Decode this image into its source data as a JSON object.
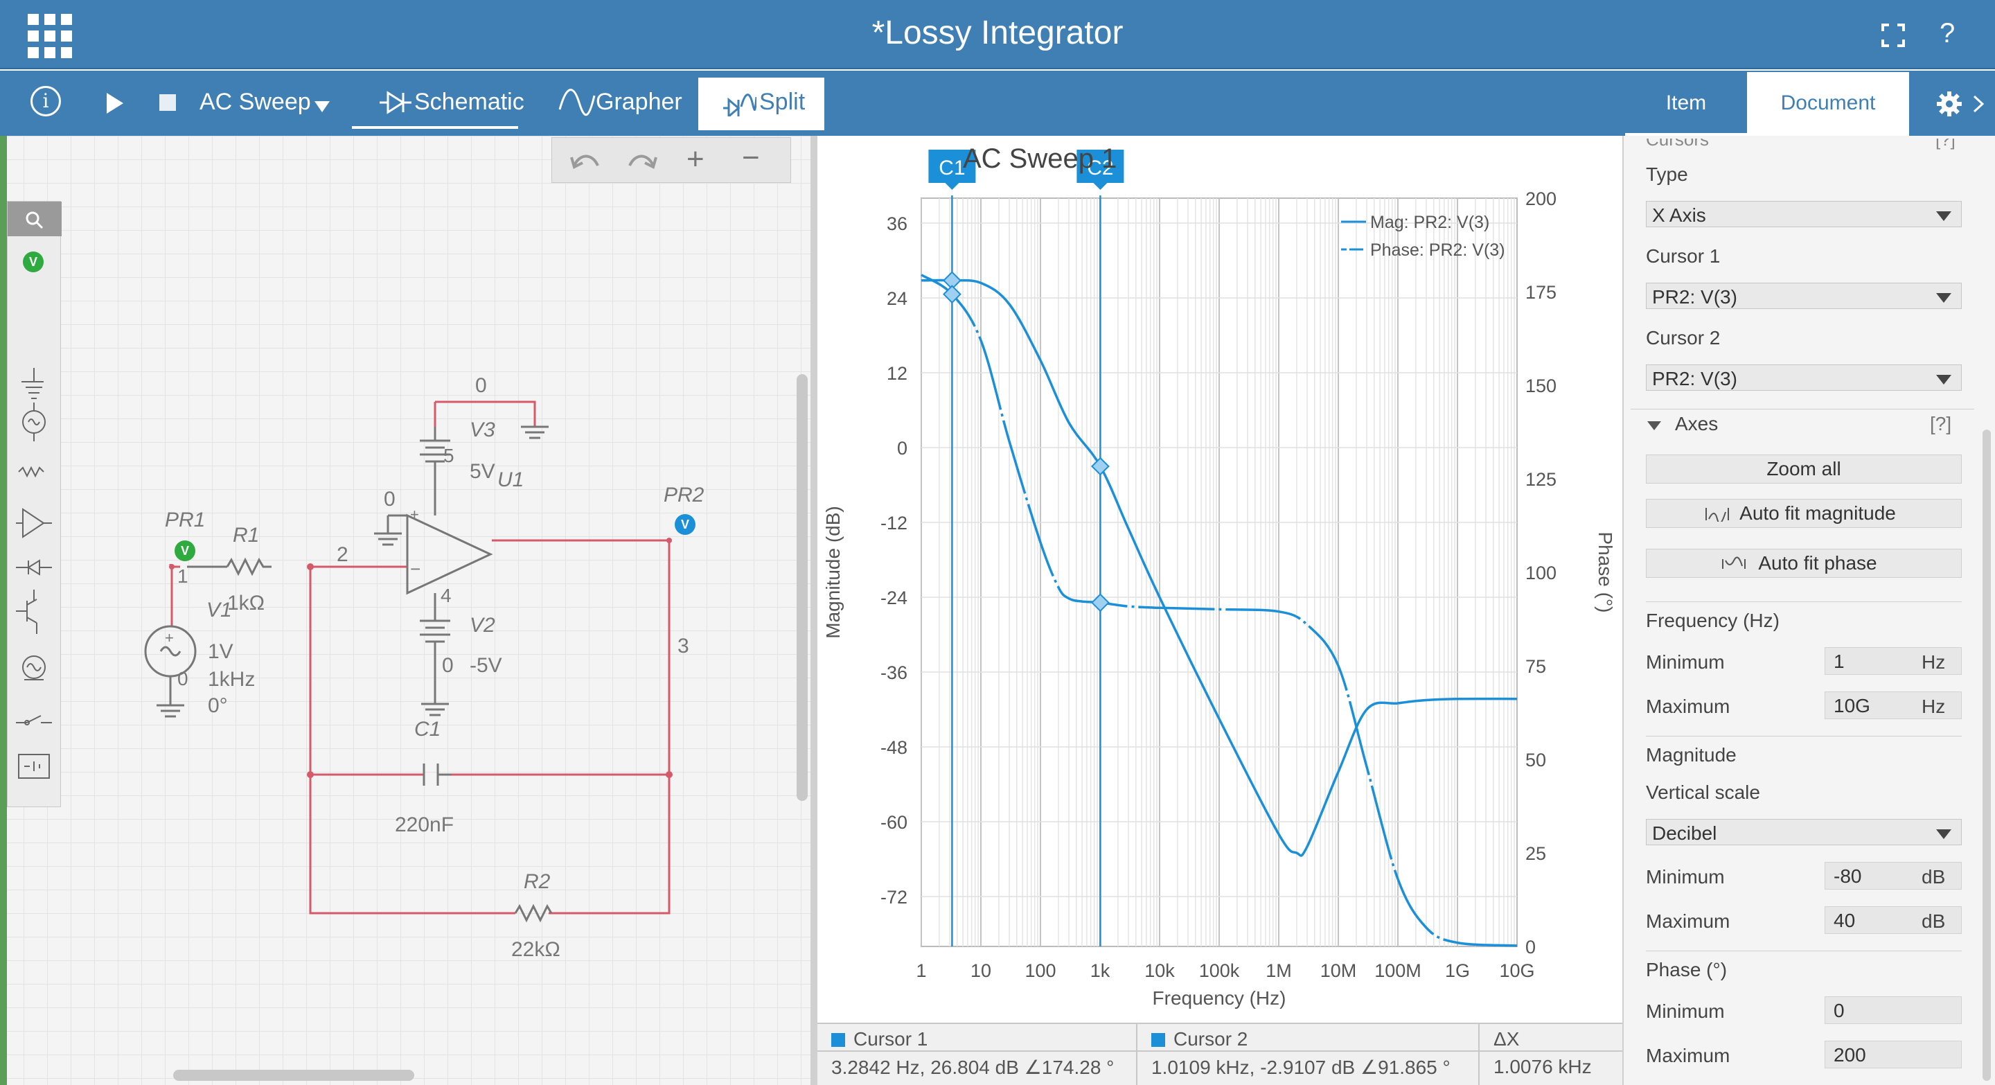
{
  "app": {
    "title": "*Lossy Integrator",
    "help": "?"
  },
  "toolbar": {
    "analysis": "AC Sweep",
    "tabs": {
      "schematic": "Schematic",
      "grapher": "Grapher",
      "split": "Split"
    },
    "info": "i"
  },
  "right_tabs": {
    "item": "Item",
    "document": "Document"
  },
  "schematic": {
    "labels": {
      "pr1": "PR1",
      "pr2": "PR2",
      "r1": "R1",
      "r1_val": "1kΩ",
      "r2": "R2",
      "r2_val": "22kΩ",
      "v1": "V1",
      "v1_amp": "1V",
      "v1_freq": "1kHz",
      "v1_phase": "0°",
      "v2": "V2",
      "v2_val": "-5V",
      "v3": "V3",
      "v3_val": "5V",
      "u1": "U1",
      "c1": "C1",
      "c1_val": "220nF",
      "node0a": "0",
      "node0b": "0",
      "node0c": "0",
      "node0d": "0",
      "node1": "1",
      "node2": "2",
      "node3": "3",
      "node4": "4",
      "node5": "5",
      "probe_v": "V"
    },
    "toolbar": {
      "plus": "+",
      "minus": "−"
    }
  },
  "chart_data": {
    "type": "line",
    "title": "AC Sweep 1",
    "xlabel": "Frequency (Hz)",
    "ylabel": "Magnitude (dB)",
    "y2label": "Phase (°)",
    "xscale": "log",
    "xlim": [
      1,
      10000000000
    ],
    "ylim": [
      -80,
      40
    ],
    "y2lim": [
      0,
      200
    ],
    "xticks": [
      "1",
      "10",
      "100",
      "1k",
      "10k",
      "100k",
      "1M",
      "10M",
      "100M",
      "1G",
      "10G"
    ],
    "yticks": [
      "36",
      "24",
      "12",
      "0",
      "-12",
      "-24",
      "-36",
      "-48",
      "-60",
      "-72"
    ],
    "y2ticks": [
      "200",
      "175",
      "150",
      "125",
      "100",
      "75",
      "50",
      "25",
      "0"
    ],
    "grid": true,
    "legend_position": "top-right",
    "series": [
      {
        "name": "Mag: PR2: V(3)",
        "axis": "left",
        "color": "#1b8fd8",
        "x": [
          1,
          3.3,
          10,
          30,
          100,
          300,
          1000,
          3000,
          10000,
          100000,
          1000000,
          2000000,
          3000000,
          10000000,
          30000000,
          100000000,
          300000000,
          1000000000,
          10000000000
        ],
        "y": [
          26.8,
          26.8,
          26.4,
          23,
          14,
          4,
          -2.9,
          -13,
          -24,
          -43.5,
          -62,
          -65,
          -64,
          -52,
          -42,
          -41,
          -40.5,
          -40.3,
          -40.3
        ]
      },
      {
        "name": "Phase: PR2: V(3)",
        "axis": "right",
        "color": "#1b8fd8",
        "dash": true,
        "x": [
          1,
          3.3,
          10,
          30,
          100,
          200,
          300,
          500,
          1000,
          3000,
          10000,
          100000,
          1000000,
          3000000,
          10000000,
          30000000,
          100000000,
          300000000,
          1000000000,
          10000000000
        ],
        "y": [
          179.5,
          174.3,
          162,
          135,
          108,
          96,
          93,
          92.2,
          91.9,
          90.9,
          90.5,
          90.1,
          89.5,
          86,
          75,
          48,
          18,
          5,
          1,
          0.2
        ]
      }
    ],
    "cursors": [
      {
        "name": "C1",
        "x": 3.2842
      },
      {
        "name": "C2",
        "x": 1010.9
      }
    ]
  },
  "cursor_table": {
    "c1_header": "Cursor 1",
    "c2_header": "Cursor 2",
    "dx_header": "ΔX",
    "c1_value": "3.2842 Hz, 26.804 dB ∠174.28 °",
    "c2_value": "1.0109 kHz, -2.9107 dB ∠91.865 °",
    "dx_value": "1.0076 kHz"
  },
  "panel": {
    "cursors_header": "Cursors",
    "help": "[?]",
    "type_label": "Type",
    "type_value": "X Axis",
    "cursor1_label": "Cursor 1",
    "cursor1_value": "PR2: V(3)",
    "cursor2_label": "Cursor 2",
    "cursor2_value": "PR2: V(3)",
    "axes_label": "Axes",
    "axes_help": "[?]",
    "zoom_all": "Zoom all",
    "auto_mag": "Auto fit magnitude",
    "auto_phase": "Auto fit phase",
    "freq_label": "Frequency (Hz)",
    "freq_min_label": "Minimum",
    "freq_min": "1",
    "freq_min_unit": "Hz",
    "freq_max_label": "Maximum",
    "freq_max": "10G",
    "freq_max_unit": "Hz",
    "mag_label": "Magnitude",
    "vscale_label": "Vertical scale",
    "vscale_value": "Decibel",
    "mag_min_label": "Minimum",
    "mag_min": "-80",
    "mag_min_unit": "dB",
    "mag_max_label": "Maximum",
    "mag_max": "40",
    "mag_max_unit": "dB",
    "phase_label": "Phase (°)",
    "phase_min_label": "Minimum",
    "phase_min": "0",
    "phase_max_label": "Maximum",
    "phase_max": "200"
  }
}
